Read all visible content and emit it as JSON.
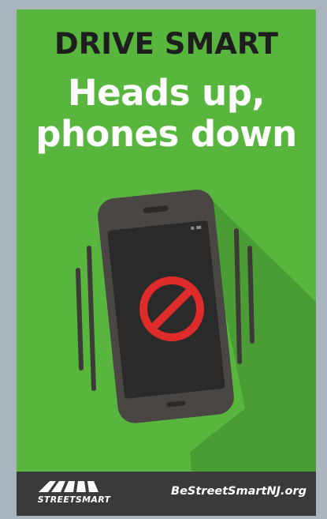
{
  "poster": {
    "headline_line1": "DRIVE SMART",
    "headline_line2": "Heads up,",
    "headline_line3": "phones down",
    "logo_text": "STREETSMART",
    "website": "BeStreetSmartNJ.org"
  },
  "colors": {
    "background_green": "#58b63f",
    "shadow_green": "#4a9c35",
    "phone_body": "#4a4644",
    "phone_screen": "#2a2a2b",
    "no_symbol_red": "#e02b2b",
    "footer_bg": "#3a3a3c",
    "text_dark": "#1e1e1e",
    "text_light": "#ffffff"
  },
  "icons": {
    "phone": "phone-icon",
    "prohibited": "no-symbol-icon",
    "vibration": "vibration-lines-icon",
    "logo": "street-smart-logo-icon"
  }
}
